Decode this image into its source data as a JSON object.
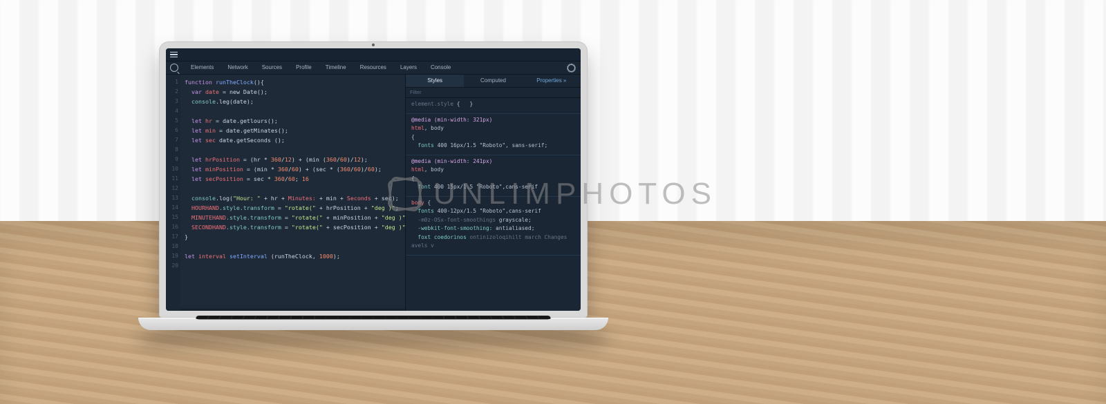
{
  "watermark_text": "UNLIMPHOTOS",
  "devtools": {
    "tabs": [
      "Elements",
      "Network",
      "Sources",
      "Profile",
      "Timeline",
      "Resources",
      "Layers",
      "Console"
    ],
    "inspector": {
      "tabs": {
        "styles": "Styles",
        "computed": "Computed",
        "properties": "Properties »"
      },
      "filter_placeholder": "Filter",
      "element_style_label": "element.style",
      "rules": [
        {
          "media": "@media (min-width: 321px)",
          "selector_a": "html",
          "selector_b": ", body",
          "open": "{",
          "lines": [
            "fonts 400 16px/1.5 \"Roboto\", sans-serif;"
          ],
          "close": ""
        },
        {
          "media": "@media (min-width: 241px)",
          "selector_a": "html",
          "selector_b": ", body",
          "open": "{",
          "lines": [
            "font 400 15px/1.5 \"Roboto\",cans-serif"
          ],
          "close": ""
        },
        {
          "media": "",
          "selector_a": "body",
          "selector_b": "",
          "open": "{",
          "lines": [
            "fonts 400-12px/1.5 \"Roboto\",cans-serif",
            "-m0z-OSx-font-smoothings grayscale;",
            "-webkit-font-smoothing: antialiased;",
            "foxt coedorinos ontinizoloqihilt march Changes avels v"
          ],
          "close": ""
        }
      ]
    }
  },
  "code": {
    "line_numbers": [
      "1",
      "2",
      "3",
      "4",
      "5",
      "6",
      "7",
      "8",
      "9",
      "10",
      "11",
      "12",
      "13",
      "14",
      "15",
      "16",
      "17",
      "18",
      "19",
      "20"
    ],
    "l1_a": "function ",
    "l1_b": "runTheClock",
    "l1_c": "(){",
    "l2_a": "  var ",
    "l2_b": "date",
    "l2_c": " = new Date();",
    "l3_a": "  console",
    "l3_b": ".leg(date);",
    "l5_a": "  let ",
    "l5_b": "hr",
    "l5_c": " = date.getlours();",
    "l6_a": "  let ",
    "l6_b": "min",
    "l6_c": " = date.getMinates();",
    "l7_a": "  let ",
    "l7_b": "sec",
    "l7_c": " date.getSeconds ();",
    "l9_a": "  let ",
    "l9_b": "hrPosition",
    "l9_c": " = (hr * ",
    "l9_d": "360",
    "l9_e": "/",
    "l9_f": "12",
    "l9_g": ") + (min (",
    "l9_h": "360",
    "l9_i": "/",
    "l9_j": "60",
    "l9_k": ")/",
    "l9_l": "12",
    "l9_m": ");",
    "l10_a": "  let ",
    "l10_b": "minPosition",
    "l10_c": " = (min * ",
    "l10_d": "360",
    "l10_e": "/",
    "l10_f": "60",
    "l10_g": ") + (sec * (",
    "l10_h": "360",
    "l10_i": "/",
    "l10_j": "60",
    "l10_k": ")/",
    "l10_l": "60",
    "l10_m": ");",
    "l11_a": "  let ",
    "l11_b": "secPosition",
    "l11_c": " = sec * ",
    "l11_d": "360",
    "l11_e": "/",
    "l11_f": "60",
    "l11_g": "; ",
    "l11_h": "16",
    "l13_a": "  console",
    "l13_b": ".log(",
    "l13_c": "\"Hour: \"",
    "l13_d": " + hr + ",
    "l13_e": "Minutes: ",
    "l13_f": "+ min + ",
    "l13_g": "Seconds ",
    "l13_h": "+ sec);",
    "l14_a": "  HOURHAND",
    "l14_b": ".style.transform",
    "l14_c": " = ",
    "l14_d": "\"rotate(\"",
    "l14_e": " + hrPosition + ",
    "l14_f": "\"deg )\"",
    "l14_g": ";",
    "l15_a": "  MINUTEHAND",
    "l15_b": ".style.transform",
    "l15_c": " = ",
    "l15_d": "\"rotate(\"",
    "l15_e": " + minPosition + ",
    "l15_f": "\"deg )\"",
    "l15_g": ";",
    "l16_a": "  SECONDHAND",
    "l16_b": ".style.transform",
    "l16_c": " = ",
    "l16_d": "\"rotate(\"",
    "l16_e": " + secPosition + ",
    "l16_f": "\"deg )\"",
    "l16_g": ";",
    "l17": "}",
    "l19_a": "let ",
    "l19_b": "interval",
    "l19_c": " ",
    "l19_d": "setInterval",
    "l19_e": " (runTheClock, ",
    "l19_f": "1000",
    "l19_g": ");"
  }
}
